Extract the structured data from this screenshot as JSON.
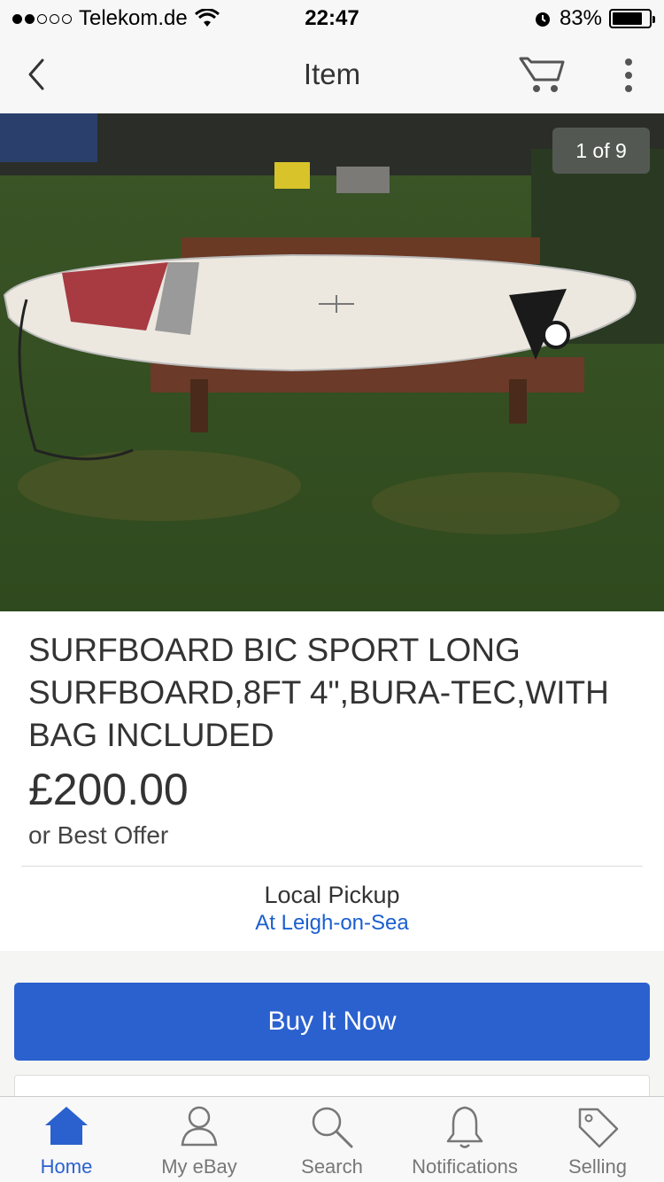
{
  "status_bar": {
    "carrier": "Telekom.de",
    "time": "22:47",
    "battery": "83%",
    "battery_level": 0.83
  },
  "nav": {
    "title": "Item"
  },
  "photo": {
    "counter": "1 of 9"
  },
  "item": {
    "title": "SURFBOARD BIC SPORT LONG SURFBOARD,8FT 4\",BURA-TEC,WITH BAG INCLUDED",
    "price": "£200.00",
    "offer": "or Best Offer",
    "pickup_label": "Local Pickup",
    "pickup_location": "At Leigh-on-Sea"
  },
  "actions": {
    "buy_now": "Buy It Now"
  },
  "tabs": [
    {
      "label": "Home",
      "icon": "home-icon",
      "active": true
    },
    {
      "label": "My eBay",
      "icon": "person-icon",
      "active": false
    },
    {
      "label": "Search",
      "icon": "search-icon",
      "active": false
    },
    {
      "label": "Notifications",
      "icon": "bell-icon",
      "active": false
    },
    {
      "label": "Selling",
      "icon": "tag-icon",
      "active": false
    }
  ],
  "colors": {
    "accent": "#2b61cf",
    "link": "#1a5fd0"
  }
}
